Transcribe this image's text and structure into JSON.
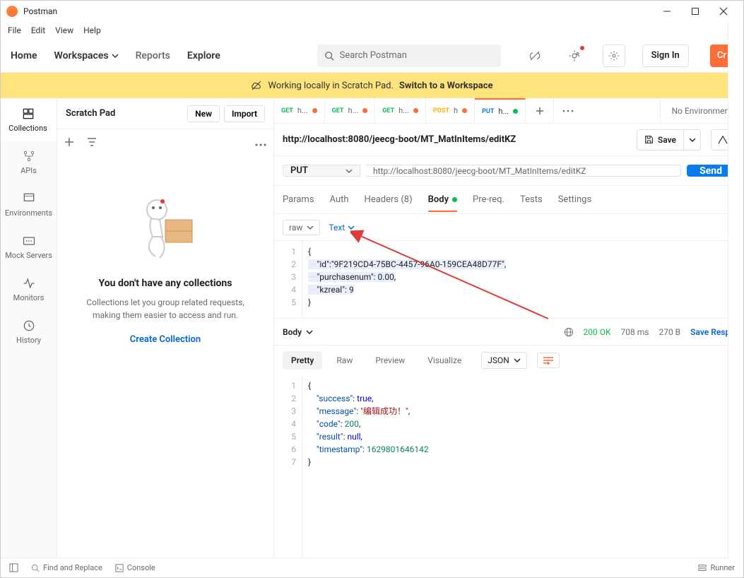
{
  "window": {
    "title": "Postman"
  },
  "menu": {
    "file": "File",
    "edit": "Edit",
    "view": "View",
    "help": "Help"
  },
  "nav": {
    "home": "Home",
    "workspaces": "Workspaces",
    "reports": "Reports",
    "explore": "Explore",
    "search_placeholder": "Search Postman",
    "signin": "Sign In",
    "create": "Cr"
  },
  "banner": {
    "text": "Working locally in Scratch Pad.",
    "link": "Switch to a Workspace"
  },
  "leftpane": {
    "title": "Scratch Pad",
    "new": "New",
    "import": "Import",
    "rail": {
      "collections": "Collections",
      "apis": "APIs",
      "environments": "Environments",
      "mock": "Mock Servers",
      "monitors": "Monitors",
      "history": "History"
    },
    "empty_title": "You don't have any collections",
    "empty_sub": "Collections let you group related requests, making them easier to access and run.",
    "create_link": "Create Collection"
  },
  "tabs": [
    {
      "method": "GET",
      "label": "h...",
      "dotcolor": "orange"
    },
    {
      "method": "GET",
      "label": "h...",
      "dotcolor": "orange"
    },
    {
      "method": "GET",
      "label": "h...",
      "dotcolor": "orange"
    },
    {
      "method": "POST",
      "label": "h",
      "dotcolor": "orange"
    },
    {
      "method": "PUT",
      "label": "h...",
      "dotcolor": "green"
    }
  ],
  "env": {
    "label": "No Environment"
  },
  "request": {
    "title": "http://localhost:8080/jeecg-boot/MT_MatInItems/editKZ",
    "method": "PUT",
    "url": "http://localhost:8080/jeecg-boot/MT_MatInItems/editKZ",
    "save": "Save",
    "send": "Send"
  },
  "subtabs": {
    "params": "Params",
    "auth": "Auth",
    "headers": "Headers (8)",
    "body": "Body",
    "prereq": "Pre-req.",
    "tests": "Tests",
    "settings": "Settings"
  },
  "bodytype": {
    "raw": "raw",
    "text": "Text"
  },
  "editor": {
    "lines": [
      "1",
      "2",
      "3",
      "4",
      "5"
    ],
    "l1": "{",
    "l2_key": "\"id\"",
    "l2_val": "\"9F219CD4-75BC-4457-96A0-159CEA48D77F\"",
    "l3_key": "\"purchasenum\"",
    "l3_val": "0.00",
    "l4_key": "\"kzreal\"",
    "l4_val": "9",
    "l5": "}"
  },
  "response": {
    "label": "Body",
    "status": "200 OK",
    "time": "708 ms",
    "size": "270 B",
    "savelink": "Save Respo",
    "pretty": "Pretty",
    "raw": "Raw",
    "preview": "Preview",
    "visualize": "Visualize",
    "json": "JSON",
    "lines": [
      "1",
      "2",
      "3",
      "4",
      "5",
      "6",
      "7"
    ],
    "l1": "{",
    "k_success": "\"success\"",
    "v_success": "true",
    "k_message": "\"message\"",
    "v_message": "\"编辑成功！\"",
    "k_code": "\"code\"",
    "v_code": "200",
    "k_result": "\"result\"",
    "v_result": "null",
    "k_timestamp": "\"timestamp\"",
    "v_timestamp": "1629801646142",
    "l7": "}"
  },
  "footer": {
    "find": "Find and Replace",
    "console": "Console",
    "runner": "Runner"
  }
}
